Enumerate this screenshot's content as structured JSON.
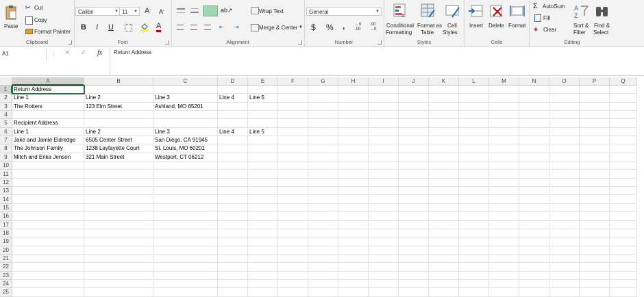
{
  "ribbon": {
    "clipboard": {
      "paste": "Paste",
      "cut": "Cut",
      "copy": "Copy",
      "format_painter": "Format Painter",
      "label": "Clipboard"
    },
    "font": {
      "name": "Calibri",
      "size": "11",
      "label": "Font",
      "font_color": "#c00000",
      "highlight_color": "#ffff00"
    },
    "alignment": {
      "wrap_text": "Wrap Text",
      "merge_center": "Merge & Center",
      "label": "Alignment"
    },
    "number": {
      "format": "General",
      "currency": "$",
      "percent": "%",
      "comma": ",",
      "label": "Number"
    },
    "styles": {
      "conditional": "Conditional",
      "formatting": "Formatting",
      "format_as": "Format as",
      "table": "Table",
      "cell": "Cell",
      "styles_label": "Styles",
      "label": "Styles"
    },
    "cells": {
      "insert": "Insert",
      "delete": "Delete",
      "format": "Format",
      "label": "Cells"
    },
    "editing": {
      "autosum": "AutoSum",
      "fill": "Fill",
      "clear": "Clear",
      "sort": "Sort &",
      "filter": "Filter",
      "find": "Find &",
      "select": "Select",
      "label": "Editing"
    }
  },
  "formula_bar": {
    "name_box": "A1",
    "fx": "fx",
    "content": "Return Address"
  },
  "columns": [
    "A",
    "B",
    "C",
    "D",
    "E",
    "F",
    "G",
    "H",
    "I",
    "J",
    "K",
    "L",
    "M",
    "N",
    "O",
    "P",
    "Q"
  ],
  "rows": [
    "1",
    "2",
    "3",
    "4",
    "5",
    "6",
    "7",
    "8",
    "9",
    "10",
    "11",
    "12",
    "13",
    "14",
    "15",
    "16",
    "17",
    "18",
    "19",
    "20",
    "21",
    "22",
    "23",
    "24",
    "25"
  ],
  "cells": [
    [
      "Return Address",
      "",
      "",
      "",
      ""
    ],
    [
      "Line 1",
      "Line 2",
      "Line 3",
      "Line 4",
      "Line 5"
    ],
    [
      "The Rotters",
      "123 Elm Street",
      "Ashland, MO 65201",
      "",
      ""
    ],
    [
      "",
      "",
      "",
      "",
      ""
    ],
    [
      "Recipient Address",
      "",
      "",
      "",
      ""
    ],
    [
      "Line 1",
      "Line 2",
      "Line 3",
      "Line 4",
      "Line 5"
    ],
    [
      "Jake and Jamie Eldredge",
      "6505 Center Street",
      "San Diego, CA 91945",
      "",
      ""
    ],
    [
      "The Johnson Family",
      "1238 Layfayette Court",
      "St. Louis, MO 60201",
      "",
      ""
    ],
    [
      "Mitch and Erika Jenson",
      "321 Main Street",
      "Westport, CT 06212",
      "",
      ""
    ]
  ],
  "accent": "#217346"
}
